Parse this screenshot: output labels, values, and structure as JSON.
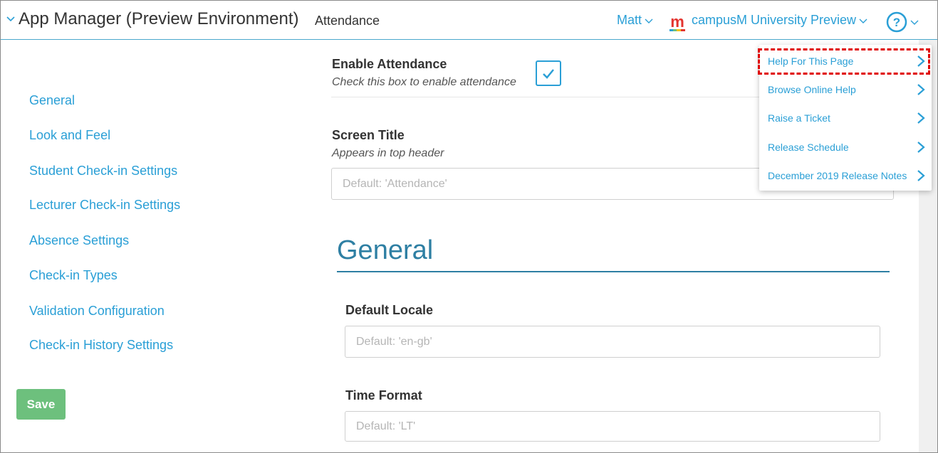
{
  "header": {
    "app_title": "App Manager (Preview Environment)",
    "page_name": "Attendance",
    "user_name": "Matt",
    "institution_name": "campusM University Preview",
    "help_glyph": "?",
    "logo_letter": "m"
  },
  "sidebar": {
    "items": [
      {
        "label": "General"
      },
      {
        "label": "Look and Feel"
      },
      {
        "label": "Student Check-in Settings"
      },
      {
        "label": "Lecturer Check-in Settings"
      },
      {
        "label": "Absence Settings"
      },
      {
        "label": "Check-in Types"
      },
      {
        "label": "Validation Configuration"
      },
      {
        "label": "Check-in History Settings"
      }
    ],
    "save_label": "Save",
    "save_color": "#6dc07d"
  },
  "content": {
    "enable": {
      "label": "Enable Attendance",
      "hint": "Check this box to enable attendance",
      "checked": true
    },
    "screen_title": {
      "label": "Screen Title",
      "hint": "Appears in top header",
      "placeholder": "Default: 'Attendance'"
    },
    "section_heading": "General",
    "default_locale": {
      "label": "Default Locale",
      "placeholder": "Default: 'en-gb'"
    },
    "time_format": {
      "label": "Time Format",
      "placeholder": "Default: 'LT'"
    }
  },
  "help_menu": {
    "items": [
      {
        "label": "Help For This Page",
        "highlighted": true
      },
      {
        "label": "Browse Online Help"
      },
      {
        "label": "Raise a Ticket"
      },
      {
        "label": "Release Schedule"
      },
      {
        "label": "December 2019 Release Notes"
      }
    ]
  },
  "colors": {
    "accent": "#2a9fd6",
    "heading": "#2e7fa3",
    "highlight": "#e00000"
  },
  "icons": {
    "app_chevron": "chevron-down-icon",
    "help": "help-circle-icon",
    "menu_chevron": "chevron-right-icon",
    "checkbox": "checkmark-icon",
    "logo": "campusm-logo-icon"
  }
}
